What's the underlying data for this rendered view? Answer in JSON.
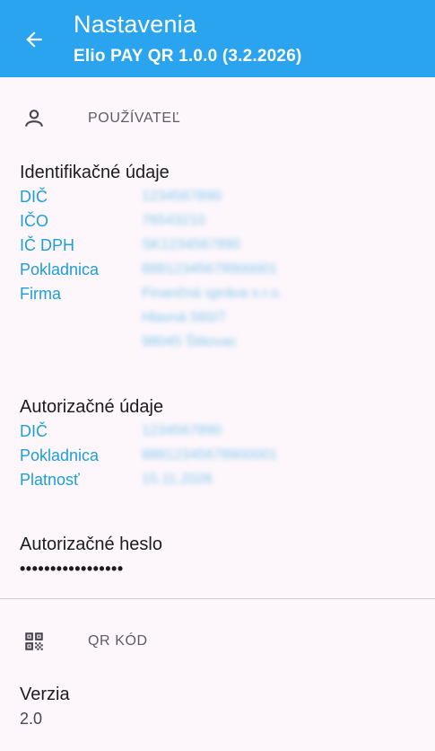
{
  "appbar": {
    "title": "Nastavenia",
    "subtitle": "Elio PAY QR 1.0.0 (3.2.2026)",
    "background_color": "#2aa4ee",
    "back_icon": "arrow-left-icon"
  },
  "user_section": {
    "header": "POUŽÍVATEĽ",
    "icon": "person-icon",
    "identification": {
      "title": "Identifikačné údaje",
      "rows": [
        {
          "label": "DIČ",
          "value": "1234567890"
        },
        {
          "label": "IČO",
          "value": "76543210"
        },
        {
          "label": "IČ DPH",
          "value": "SK1234567890"
        },
        {
          "label": "Pokladnica",
          "value": "88812345678900001"
        },
        {
          "label": "Firma",
          "value": "Finančná správa s.r.o."
        }
      ],
      "address_lines": [
        "Hlavná 560/7",
        "98045 Štitovac"
      ]
    },
    "authorization": {
      "title": "Autorizačné údaje",
      "rows": [
        {
          "label": "DIČ",
          "value": "1234567890"
        },
        {
          "label": "Pokladnica",
          "value": "88812345678900001"
        },
        {
          "label": "Platnosť",
          "value": "15.11.2026"
        }
      ]
    },
    "password": {
      "title": "Autorizačné heslo",
      "masked_value": "•••••••••••••••••"
    }
  },
  "qr_section": {
    "header": "QR KÓD",
    "icon": "qr-code-icon",
    "version": {
      "title": "Verzia",
      "value": "2.0"
    }
  }
}
